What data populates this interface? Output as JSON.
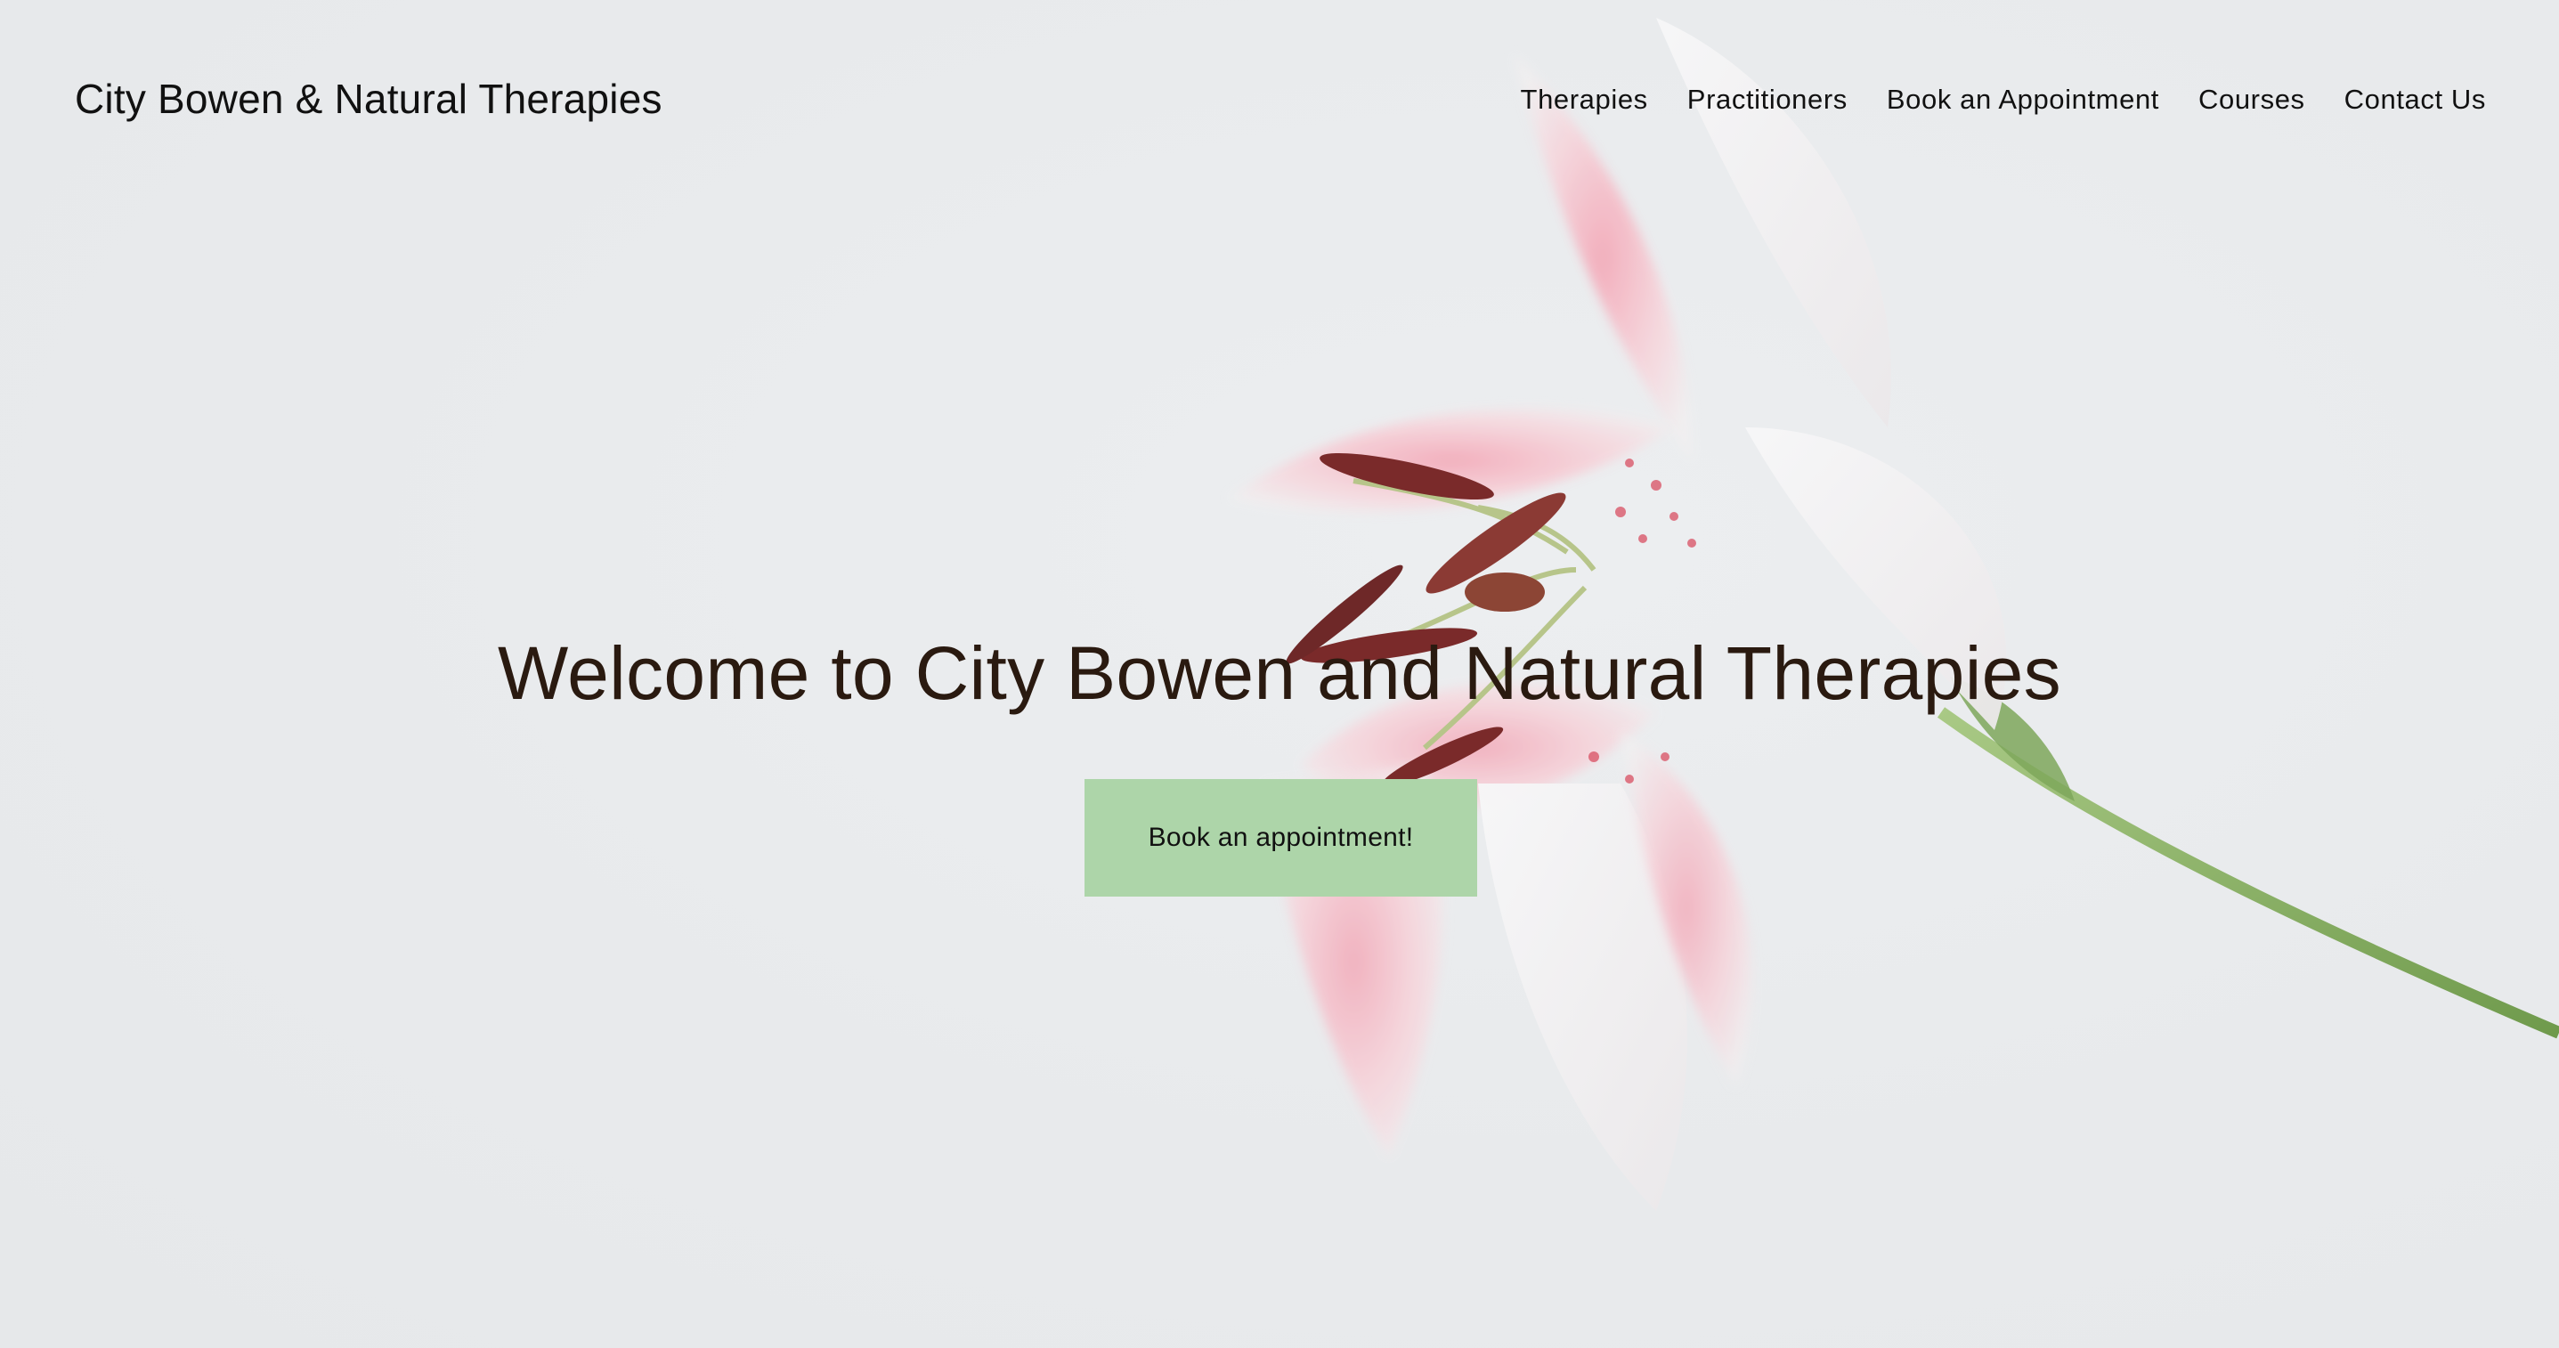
{
  "header": {
    "site_title": "City Bowen & Natural Therapies",
    "nav": [
      {
        "label": "Therapies"
      },
      {
        "label": "Practitioners"
      },
      {
        "label": "Book an Appointment"
      },
      {
        "label": "Courses"
      },
      {
        "label": "Contact Us"
      }
    ]
  },
  "hero": {
    "heading": "Welcome to City Bowen and Natural Therapies",
    "cta_label": "Book an appointment!",
    "image_subject": "pink-lily-flower"
  },
  "colors": {
    "background": "#e9ebed",
    "cta": "#add5a9",
    "heading": "#2a1a10",
    "petal": "#f2b6c0",
    "stem": "#8db36a"
  }
}
